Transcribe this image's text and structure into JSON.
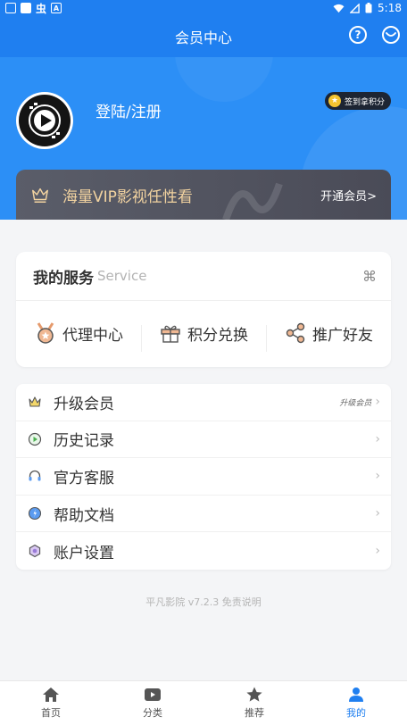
{
  "status_bar": {
    "time": "5:18",
    "app_glyph": "虫",
    "a_glyph": "A"
  },
  "header": {
    "title": "会员中心",
    "help_icon": "question-icon",
    "message_icon": "chat-icon"
  },
  "profile": {
    "login_label": "登陆/注册",
    "checkin_label": "签到拿积分"
  },
  "vip": {
    "slogan": "海量VIP影视任性看",
    "cta": "开通会员>"
  },
  "service": {
    "title": "我的服务",
    "subtitle": "Service",
    "items": [
      {
        "label": "代理中心",
        "icon": "medal-icon"
      },
      {
        "label": "积分兑换",
        "icon": "gift-icon"
      },
      {
        "label": "推广好友",
        "icon": "share-icon"
      }
    ]
  },
  "menu": [
    {
      "label": "升级会员",
      "icon": "crown-icon",
      "extra": "升级会员"
    },
    {
      "label": "历史记录",
      "icon": "play-circle-icon"
    },
    {
      "label": "官方客服",
      "icon": "headset-icon"
    },
    {
      "label": "帮助文档",
      "icon": "help-doc-icon"
    },
    {
      "label": "账户设置",
      "icon": "settings-icon"
    }
  ],
  "footer": {
    "note": "平凡影院 v7.2.3 免责说明"
  },
  "bottom_nav": [
    {
      "label": "首页",
      "icon": "home-icon"
    },
    {
      "label": "分类",
      "icon": "video-icon"
    },
    {
      "label": "推荐",
      "icon": "star-icon"
    },
    {
      "label": "我的",
      "icon": "user-icon",
      "active": true
    }
  ],
  "colors": {
    "primary": "#1f7ff0",
    "hero": "#2c8ff6",
    "vip_gold": "#f2d3a0",
    "vip_bg": "#4f515d"
  }
}
